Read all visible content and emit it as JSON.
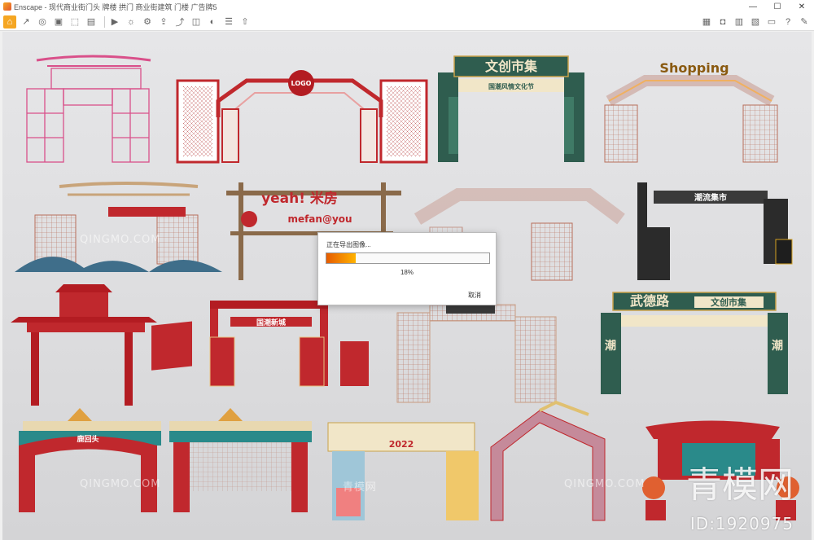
{
  "window": {
    "title": "Enscape - 现代商业街门头 牌楼 拱门 商业街建筑 门楼 广告牌5",
    "minimize": "—",
    "maximize": "☐",
    "close": "✕"
  },
  "toolbar": {
    "left_icons": [
      "home-icon",
      "arrow-icon",
      "render-icon",
      "asset-icon",
      "view-icon",
      "screenshot-icon",
      "video-icon",
      "sun-icon",
      "settings-icon",
      "export-icon",
      "share-icon",
      "vr-icon",
      "panorama-icon",
      "batch-icon",
      "upload-icon"
    ],
    "right_icons": [
      "map-icon",
      "camera-icon",
      "book-icon",
      "views-icon",
      "display-icon",
      "help-icon",
      "feedback-icon"
    ]
  },
  "viewport": {
    "gate_labels": {
      "logo": "LOGO",
      "wenchuang": "文创市集",
      "wenchuang_sub": "国潮风情文化节",
      "shopping": "Shopping",
      "yeah": "yeah! 米房",
      "yeah_sub": "mefan@you",
      "zhixun": "潮流集市",
      "wude": "武德路",
      "wude_sign": "文创市集",
      "chao": "潮",
      "guochao": "国潮新城",
      "date": "2022",
      "jiayuan": "鹿回头"
    },
    "watermarks": [
      "QINGMO.COM",
      "QINGMO.COM",
      "QINGMO.COM",
      "青模网"
    ],
    "watermark_logo": "青模网",
    "watermark_id": "ID:1920975"
  },
  "dialog": {
    "message": "正在导出图像...",
    "progress": 0.18,
    "percent_text": "18%",
    "cancel_label": "取消"
  },
  "colors": {
    "accent": "#f5a623",
    "progress_start": "#e65c00",
    "progress_end": "#ffb300",
    "pink": "#d9508a",
    "red": "#c0282d",
    "green": "#2f5d4f",
    "gold": "#c9a24a"
  }
}
